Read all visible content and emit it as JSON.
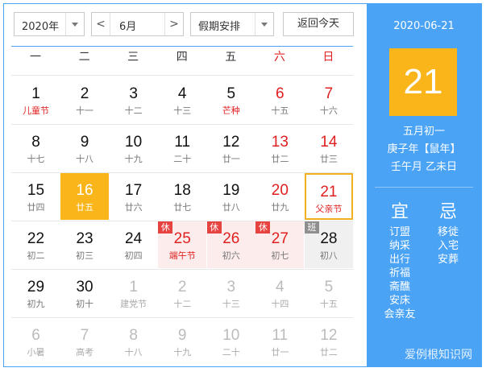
{
  "toolbar": {
    "year": "2020年",
    "prev": "<",
    "month": "6月",
    "next": ">",
    "holiday_select": "假期安排",
    "today_button": "返回今天"
  },
  "weekdays": [
    "一",
    "二",
    "三",
    "四",
    "五",
    "六",
    "日"
  ],
  "rows": [
    [
      {
        "d": "1",
        "l": "儿童节",
        "fest": true
      },
      {
        "d": "2",
        "l": "十一"
      },
      {
        "d": "3",
        "l": "十二"
      },
      {
        "d": "4",
        "l": "十三"
      },
      {
        "d": "5",
        "l": "芒种",
        "fest": true
      },
      {
        "d": "6",
        "l": "十五",
        "we": true
      },
      {
        "d": "7",
        "l": "十六",
        "we": true
      }
    ],
    [
      {
        "d": "8",
        "l": "十七"
      },
      {
        "d": "9",
        "l": "十八"
      },
      {
        "d": "10",
        "l": "十九"
      },
      {
        "d": "11",
        "l": "二十"
      },
      {
        "d": "12",
        "l": "廿一"
      },
      {
        "d": "13",
        "l": "廿二",
        "we": true
      },
      {
        "d": "14",
        "l": "廿三",
        "we": true
      }
    ],
    [
      {
        "d": "15",
        "l": "廿四"
      },
      {
        "d": "16",
        "l": "廿五",
        "today": true
      },
      {
        "d": "17",
        "l": "廿六"
      },
      {
        "d": "18",
        "l": "廿七"
      },
      {
        "d": "19",
        "l": "廿八"
      },
      {
        "d": "20",
        "l": "廿九",
        "we": true
      },
      {
        "d": "21",
        "l": "父亲节",
        "we": true,
        "fest": true,
        "selected": true
      }
    ],
    [
      {
        "d": "22",
        "l": "初二"
      },
      {
        "d": "23",
        "l": "初三"
      },
      {
        "d": "24",
        "l": "初四"
      },
      {
        "d": "25",
        "l": "端午节",
        "fest": true,
        "we": true,
        "hol": true,
        "tag": "休"
      },
      {
        "d": "26",
        "l": "初六",
        "we": true,
        "hol": true,
        "tag": "休"
      },
      {
        "d": "27",
        "l": "初七",
        "we": true,
        "hol": true,
        "tag": "休"
      },
      {
        "d": "28",
        "l": "初八",
        "work": true,
        "tag": "班"
      }
    ],
    [
      {
        "d": "29",
        "l": "初九"
      },
      {
        "d": "30",
        "l": "初十"
      },
      {
        "d": "1",
        "l": "建党节",
        "dim": true
      },
      {
        "d": "2",
        "l": "十二",
        "dim": true
      },
      {
        "d": "3",
        "l": "十三",
        "dim": true
      },
      {
        "d": "4",
        "l": "十四",
        "dim": true
      },
      {
        "d": "5",
        "l": "十五",
        "dim": true
      }
    ],
    [
      {
        "d": "6",
        "l": "小暑",
        "dim": true
      },
      {
        "d": "7",
        "l": "高考",
        "dim": true
      },
      {
        "d": "8",
        "l": "十八",
        "dim": true
      },
      {
        "d": "9",
        "l": "十九",
        "dim": true
      },
      {
        "d": "10",
        "l": "二十",
        "dim": true
      },
      {
        "d": "11",
        "l": "廿一",
        "dim": true
      },
      {
        "d": "12",
        "l": "廿二",
        "dim": true
      }
    ]
  ],
  "side": {
    "date": "2020-06-21",
    "day": "21",
    "lunar": "五月初一",
    "ganzhi_year": "庚子年【鼠年】",
    "ganzhi_mday": "壬午月 乙未日",
    "yi_title": "宜",
    "ji_title": "忌",
    "yi": [
      "订盟",
      "纳采",
      "出行",
      "祈福",
      "斋醮",
      "安床",
      "会亲友"
    ],
    "ji": [
      "移徙",
      "入宅",
      "安葬"
    ]
  },
  "watermark": "爱例根知识网",
  "colors": {
    "accent": "#4aa3f5",
    "today": "#f9b51a",
    "holiday_red": "#e02020"
  }
}
